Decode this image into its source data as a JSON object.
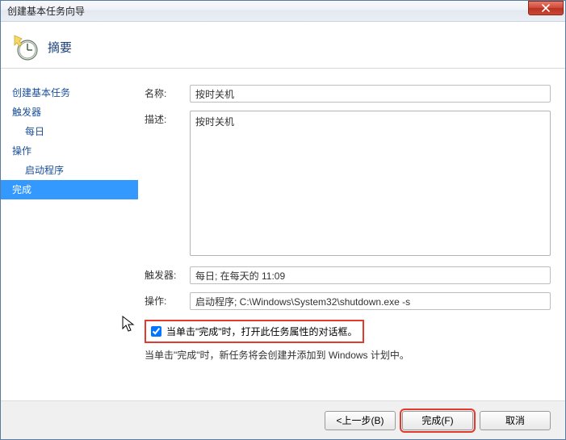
{
  "window": {
    "title": "创建基本任务向导"
  },
  "header": {
    "title": "摘要"
  },
  "sidebar": {
    "items": [
      {
        "label": "创建基本任务",
        "sub": false,
        "selected": false
      },
      {
        "label": "触发器",
        "sub": false,
        "selected": false
      },
      {
        "label": "每日",
        "sub": true,
        "selected": false
      },
      {
        "label": "操作",
        "sub": false,
        "selected": false
      },
      {
        "label": "启动程序",
        "sub": true,
        "selected": false
      },
      {
        "label": "完成",
        "sub": false,
        "selected": true
      }
    ]
  },
  "form": {
    "name_label": "名称:",
    "name_value": "按时关机",
    "desc_label": "描述:",
    "desc_value": "按时关机",
    "trigger_label": "触发器:",
    "trigger_value": "每日; 在每天的 11:09",
    "action_label": "操作:",
    "action_value": "启动程序; C:\\Windows\\System32\\shutdown.exe -s",
    "checkbox_label": "当单击\"完成\"时，打开此任务属性的对话框。",
    "checkbox_checked": true,
    "info_line": "当单击\"完成\"时，新任务将会创建并添加到 Windows 计划中。"
  },
  "footer": {
    "back_label": "<上一步(B)",
    "finish_label": "完成(F)",
    "cancel_label": "取消"
  }
}
